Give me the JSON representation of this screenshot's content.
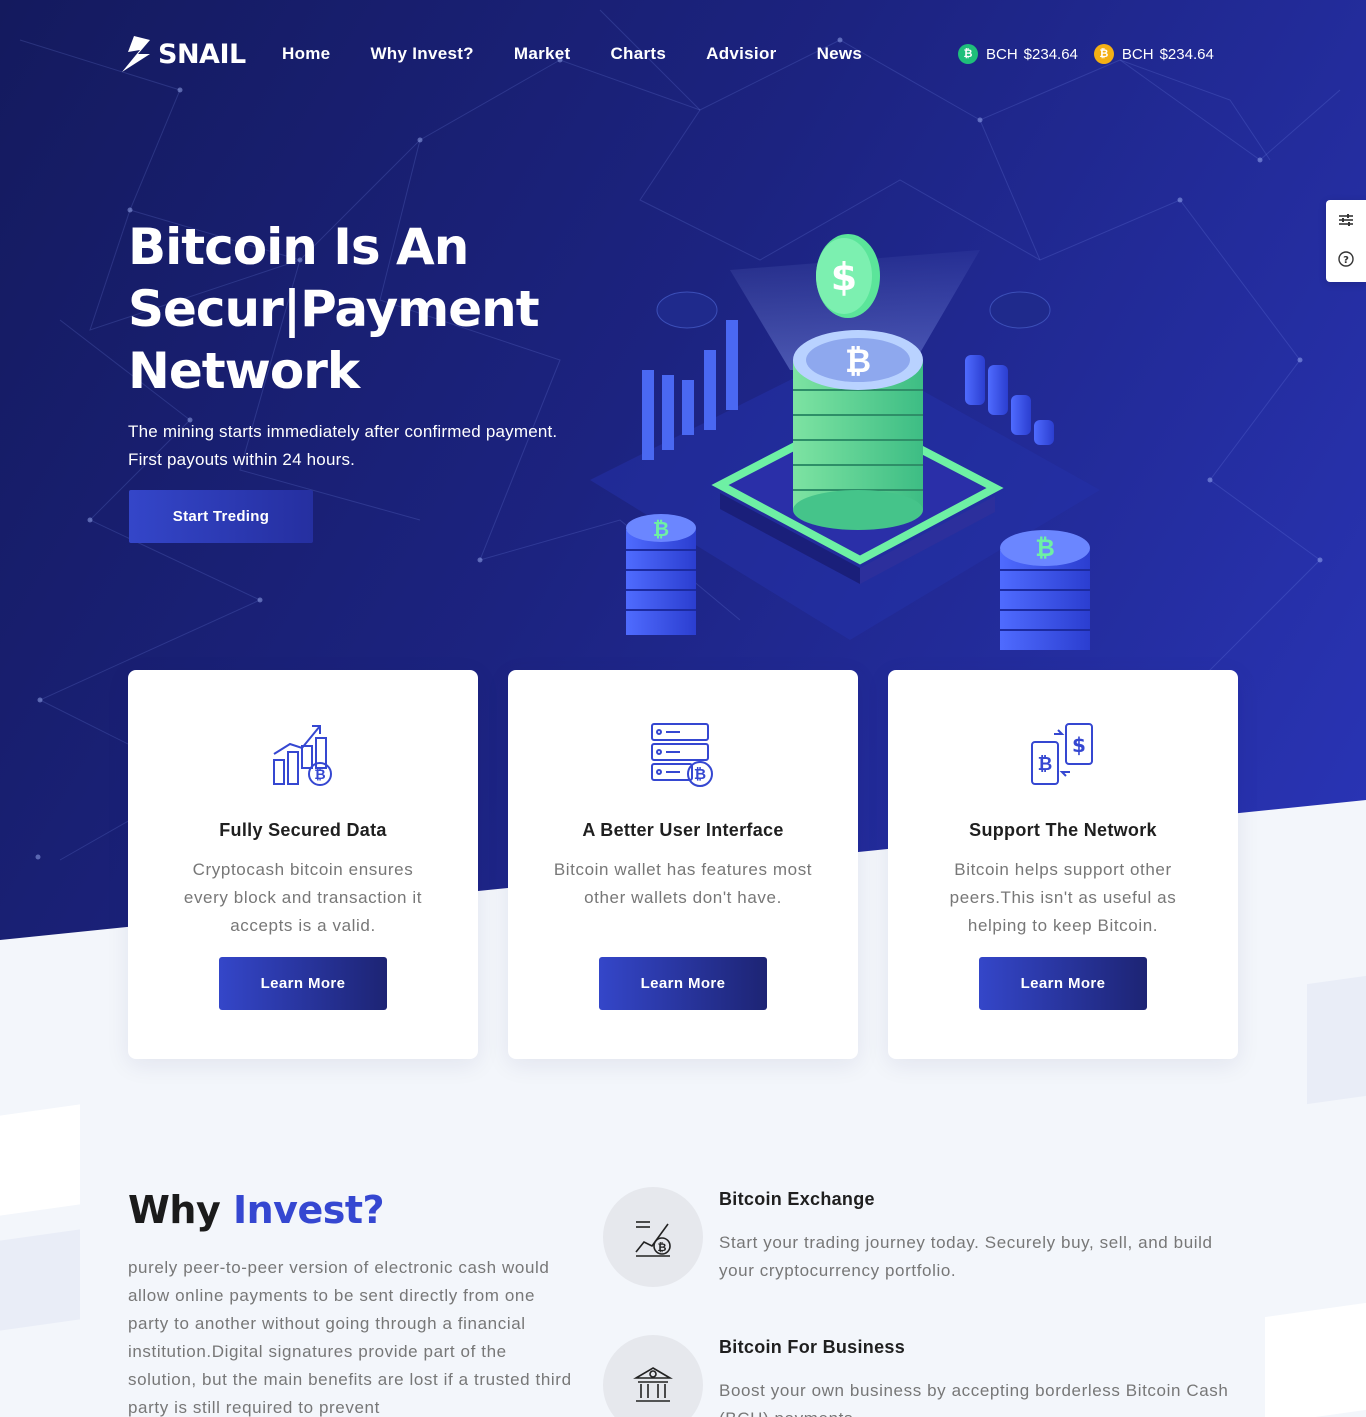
{
  "brand": {
    "name": "SNAIL"
  },
  "nav": {
    "items": [
      {
        "label": "Home"
      },
      {
        "label": "Why Invest?"
      },
      {
        "label": "Market"
      },
      {
        "label": "Charts"
      },
      {
        "label": "Advisior"
      },
      {
        "label": "News"
      }
    ]
  },
  "ticker": [
    {
      "symbol": "BCH",
      "price": "$234.64",
      "color": "#1fbf7a"
    },
    {
      "symbol": "BCH",
      "price": "$234.64",
      "color": "#f4b014"
    }
  ],
  "side_tools": {
    "icons": [
      "settings-sliders-icon",
      "help-icon"
    ]
  },
  "hero": {
    "title_line1": "Bitcoin Is An",
    "title_line2": "Secur|Payment",
    "title_line3": "Network",
    "subtitle": "The mining starts immediately after confirmed payment. First payouts within 24 hours.",
    "cta": "Start Treding"
  },
  "features": [
    {
      "icon": "bitcoin-growth-chart-icon",
      "title": "Fully Secured Data",
      "text": "Cryptocash bitcoin ensures every block and transaction it accepts is a valid.",
      "button": "Learn More"
    },
    {
      "icon": "bitcoin-server-icon",
      "title": "A Better User Interface",
      "text": "Bitcoin wallet has features most other wallets don't have.",
      "button": "Learn More"
    },
    {
      "icon": "bitcoin-exchange-phone-icon",
      "title": "Support The Network",
      "text": "Bitcoin helps support other peers.This isn't as useful as helping to keep Bitcoin.",
      "button": "Learn More"
    }
  ],
  "why": {
    "title_plain": "Why",
    "title_accent": "Invest?",
    "text": "purely peer-to-peer version of electronic cash would allow online payments to be sent directly from one party to another without going through a financial institution.Digital signatures provide part of the solution, but the main benefits are lost if a trusted third party is still required to prevent",
    "accent_color": "#3547d1",
    "items": [
      {
        "icon": "bitcoin-exchange-icon",
        "title": "Bitcoin Exchange",
        "text": "Start your trading journey today. Securely buy, sell, and build your cryptocurrency portfolio."
      },
      {
        "icon": "bank-icon",
        "title": "Bitcoin For Business",
        "text": "Boost your own business by accepting borderless Bitcoin Cash (BCH) payments."
      }
    ]
  }
}
